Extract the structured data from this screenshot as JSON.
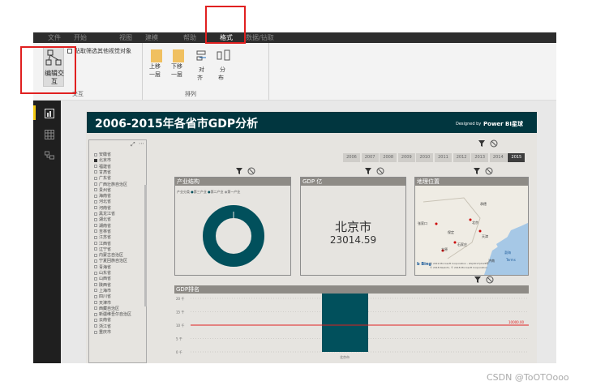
{
  "tabs": [
    "文件",
    "开始",
    "视图",
    "建模",
    "帮助",
    "格式",
    "数据/钻取"
  ],
  "ribbon": {
    "interaction_btn": "编辑交互",
    "checkbox_label": "贴取筛选其他视觉对象",
    "group_interact": "交互",
    "bring_forward": [
      "上移",
      "一层"
    ],
    "send_backward": [
      "下移",
      "一层"
    ],
    "align": [
      "对",
      "齐"
    ],
    "distribute": [
      "分",
      "布"
    ],
    "group_arrange": "排列"
  },
  "report": {
    "title": "2006-2015年各省市GDP分析",
    "designed_by": "Designed by",
    "brand": "Power BI星球",
    "years": [
      "2006",
      "2007",
      "2008",
      "2009",
      "2010",
      "2011",
      "2012",
      "2013",
      "2014",
      "2015"
    ],
    "selected_year": "2015",
    "provinces": [
      "安徽省",
      "北京市",
      "福建省",
      "甘肃省",
      "广东省",
      "广西壮族自治区",
      "贵州省",
      "海南省",
      "河北省",
      "河南省",
      "黑龙江省",
      "湖北省",
      "湖南省",
      "吉林省",
      "江苏省",
      "江西省",
      "辽宁省",
      "内蒙古自治区",
      "宁夏回族自治区",
      "青海省",
      "山东省",
      "山西省",
      "陕西省",
      "上海市",
      "四川省",
      "天津市",
      "西藏自治区",
      "新疆维吾尔自治区",
      "云南省",
      "浙江省",
      "重庆市"
    ],
    "selected_province": "北京市",
    "industry_panel": {
      "title": "产业结构",
      "legend_title": "产业分类",
      "legend": [
        "第三产业",
        "第二产业",
        "第一产业"
      ]
    },
    "gdp_panel": {
      "title": "GDP 亿",
      "city": "北京市",
      "value": "23014.59"
    },
    "map_panel": {
      "title": "地理位置",
      "labels": [
        "北京",
        "天津",
        "石家庄",
        "太原",
        "济南",
        "张家口",
        "渤海",
        "保定",
        "承德"
      ],
      "copyright": "© 2019 Microsoft Corporation - GS(2017)2128号",
      "copyright2": "© 2018 NavInfo, © 2018 Microsoft Corporation",
      "terms": "Terms",
      "bing": "b Bing"
    },
    "rank_panel": {
      "title": "GDP排名",
      "yticks": [
        "20 千",
        "15 千",
        "10 千",
        "5 千",
        "0 千"
      ],
      "ref_label": "10000.00",
      "bar_label": "北京市"
    }
  },
  "watermark": "CSDN @ToOTOooo",
  "colors": {
    "header": "#01363f",
    "bar": "#01505c",
    "ref": "#e02020"
  },
  "chart_data": {
    "type": "bar",
    "categories": [
      "北京市"
    ],
    "values": [
      23014.59
    ],
    "ylim": [
      0,
      20000
    ],
    "reference_line": 10000
  }
}
